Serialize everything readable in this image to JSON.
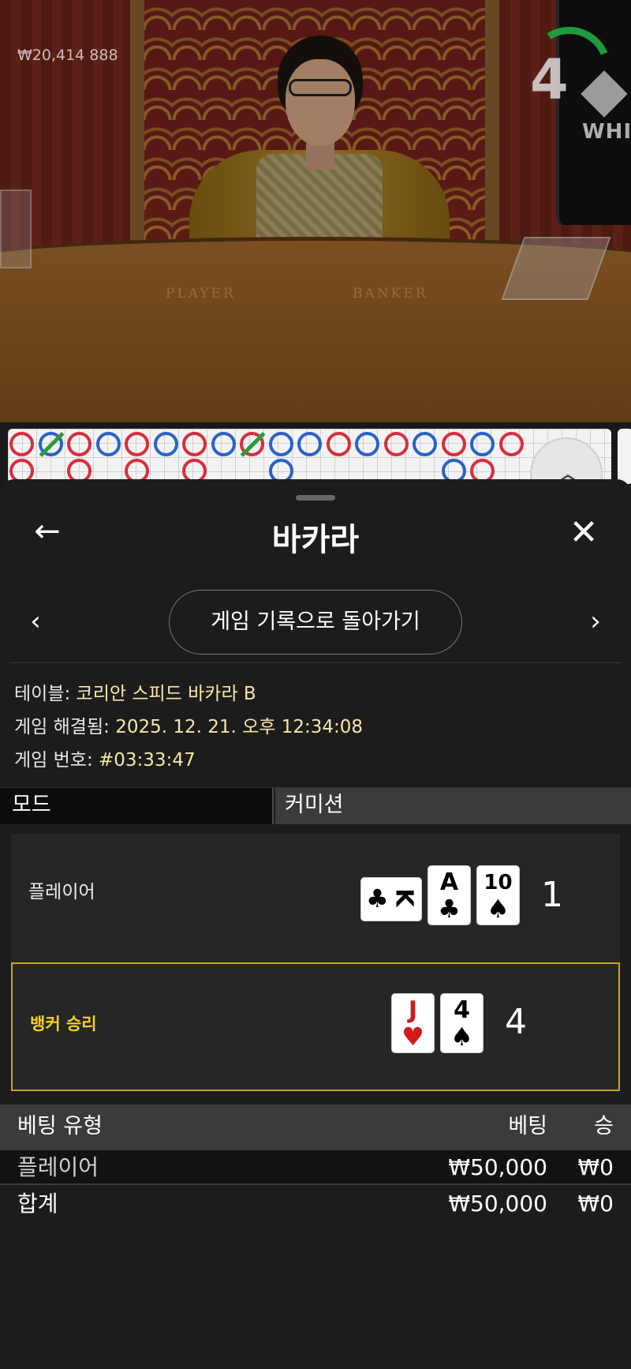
{
  "stream": {
    "balance": "₩20,414 888",
    "timer": "4",
    "monitor_brand": "WHITE",
    "table_labels": [
      "PLAYER",
      "BANKER"
    ]
  },
  "road": {
    "row1": [
      "r",
      "b",
      "r",
      "b",
      "r",
      "b",
      "r",
      "b",
      "r",
      "b",
      "b",
      "r",
      "b",
      "r",
      "b",
      "r",
      "b",
      "r"
    ],
    "row2": [
      "r",
      "",
      "r",
      "",
      "r",
      "",
      "r",
      "",
      "",
      "b",
      "",
      "",
      "",
      "",
      "",
      "b",
      "r",
      ""
    ]
  },
  "header": {
    "title": "바카라",
    "back_icon": "arrow-left-icon",
    "close_icon": "close-icon"
  },
  "nav": {
    "prev": "‹",
    "next": "›",
    "back_to_history": "게임 기록으로 돌아가기"
  },
  "info": {
    "table_label": "테이블:",
    "table_value": "코리안 스피드 바카라 B",
    "resolved_label": "게임 해결됨:",
    "resolved_value": "2025. 12. 21. 오후 12:34:08",
    "game_no_label": "게임 번호:",
    "game_no_value": "#03:33:47"
  },
  "tabs": {
    "mode": "모드",
    "commission": "커미션"
  },
  "player": {
    "label": "플레이어",
    "cards": [
      {
        "rank": "K",
        "suit": "♣",
        "color": "#000000",
        "rotated": true
      },
      {
        "rank": "A",
        "suit": "♣",
        "color": "#000000",
        "rotated": false
      },
      {
        "rank": "10",
        "suit": "♠",
        "color": "#000000",
        "rotated": false
      }
    ],
    "total": "1"
  },
  "banker": {
    "label": "뱅커 승리",
    "cards": [
      {
        "rank": "J",
        "suit": "♥",
        "color": "#d11a1a",
        "rotated": false
      },
      {
        "rank": "4",
        "suit": "♠",
        "color": "#000000",
        "rotated": false
      }
    ],
    "total": "4",
    "highlight_color": "#c9a51b"
  },
  "bets": {
    "headers": [
      "베팅 유형",
      "베팅",
      "승"
    ],
    "rows": [
      {
        "type": "플레이어",
        "bet": "₩50,000",
        "win": "₩0"
      }
    ],
    "total": {
      "type": "합계",
      "bet": "₩50,000",
      "win": "₩0"
    }
  }
}
